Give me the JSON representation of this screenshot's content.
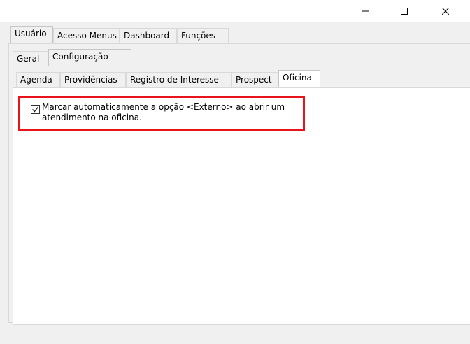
{
  "window": {
    "controls": [
      {
        "name": "minimize-icon"
      },
      {
        "name": "maximize-icon"
      },
      {
        "name": "close-icon"
      }
    ]
  },
  "main_tabs": [
    {
      "label": "Usuário",
      "active": true
    },
    {
      "label": "Acesso Menus",
      "active": false
    },
    {
      "label": "Dashboard",
      "active": false
    },
    {
      "label": "Funções",
      "active": false
    }
  ],
  "sub_tabs": [
    {
      "label": "Geral",
      "active": false
    },
    {
      "label": "Configuração",
      "active": true
    }
  ],
  "config_tabs": [
    {
      "label": "Agenda",
      "active": false
    },
    {
      "label": "Providências",
      "active": false
    },
    {
      "label": "Registro de Interesse",
      "active": false
    },
    {
      "label": "Prospect",
      "active": false
    },
    {
      "label": "Oficina",
      "active": true
    }
  ],
  "oficina": {
    "checkbox_checked": true,
    "checkbox_label_line1": "Marcar automaticamente a opção <Externo> ao abrir um",
    "checkbox_label_line2": "atendimento na oficina."
  },
  "colors": {
    "highlight_border": "#e8141b",
    "dialog_bg": "#f0f0f0"
  }
}
